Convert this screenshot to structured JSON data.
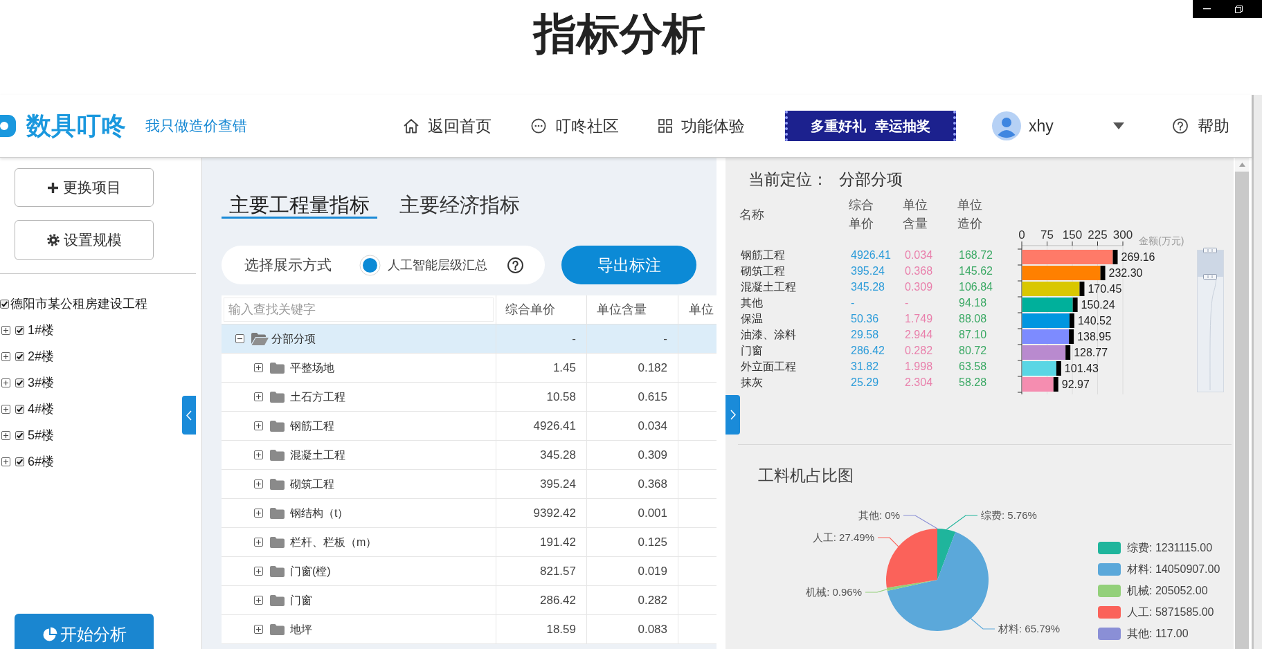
{
  "title": "指标分析",
  "header": {
    "logo": "数具叮咚",
    "slogan": "我只做造价查错",
    "nav": [
      {
        "label": "返回首页",
        "kind": "home"
      },
      {
        "label": "叮咚社区",
        "kind": "chat"
      },
      {
        "label": "功能体验",
        "kind": "grid"
      }
    ],
    "banner": "多重好礼 幸运抽奖",
    "user": {
      "name": "xhy"
    },
    "help": "帮助"
  },
  "sidebar": {
    "buttons": [
      {
        "label": "更换项目",
        "kind": "plus"
      },
      {
        "label": "设置规模",
        "kind": "gear"
      }
    ],
    "tree": [
      {
        "label": "德阳市某公租房建设工程",
        "checked": true,
        "children": [
          {
            "label": "1#楼",
            "checked": true,
            "expanded": false
          },
          {
            "label": "2#楼",
            "checked": true,
            "expanded": false
          },
          {
            "label": "3#楼",
            "checked": true,
            "expanded": false
          },
          {
            "label": "4#楼",
            "checked": true,
            "expanded": false
          },
          {
            "label": "5#楼",
            "checked": true,
            "expanded": false
          },
          {
            "label": "6#楼",
            "checked": true,
            "expanded": false
          }
        ]
      }
    ],
    "start_button": "开始分析"
  },
  "main": {
    "tabs": [
      {
        "label": "主要工程量指标",
        "selected": true
      },
      {
        "label": "主要经济指标",
        "selected": false
      }
    ],
    "display_mode": {
      "label": "选择展示方式",
      "options": [
        {
          "label": "人工智能层级汇总",
          "selected": true
        }
      ]
    },
    "export_button": "导出标注",
    "table": {
      "search": {
        "placeholder": "输入查找关键字"
      },
      "columns": [
        "综合单价",
        "单位含量",
        "单位"
      ],
      "rows": [
        {
          "name": "分部分项",
          "expanded": true,
          "selected": true,
          "cells": [
            "-",
            "-"
          ],
          "children": [
            {
              "name": "平整场地",
              "expanded": false,
              "selected": false,
              "cells": [
                "1.45",
                "0.182"
              ]
            },
            {
              "name": "土石方工程",
              "expanded": false,
              "selected": false,
              "cells": [
                "10.58",
                "0.615"
              ]
            },
            {
              "name": "钢筋工程",
              "expanded": false,
              "selected": false,
              "cells": [
                "4926.41",
                "0.034"
              ]
            },
            {
              "name": "混凝土工程",
              "expanded": false,
              "selected": false,
              "cells": [
                "345.28",
                "0.309"
              ]
            },
            {
              "name": "砌筑工程",
              "expanded": false,
              "selected": false,
              "cells": [
                "395.24",
                "0.368"
              ]
            },
            {
              "name": "钢结构（t）",
              "expanded": false,
              "selected": false,
              "cells": [
                "9392.42",
                "0.001"
              ]
            },
            {
              "name": "栏杆、栏板（m）",
              "expanded": false,
              "selected": false,
              "cells": [
                "191.42",
                "0.125"
              ]
            },
            {
              "name": "门窗(樘)",
              "expanded": false,
              "selected": false,
              "cells": [
                "821.57",
                "0.019"
              ]
            },
            {
              "name": "门窗",
              "expanded": false,
              "selected": false,
              "cells": [
                "286.42",
                "0.282"
              ]
            },
            {
              "name": "地坪",
              "expanded": false,
              "selected": false,
              "cells": [
                "18.59",
                "0.083"
              ]
            }
          ]
        }
      ]
    }
  },
  "detail": {
    "location_label": "当前定位：",
    "location": "分部分项",
    "columns": [
      "名称",
      "综合单价",
      "单位含量",
      "单位造价"
    ],
    "rows": [
      {
        "name": "钢筋工程",
        "unit_price": "4926.41",
        "unit_content": "0.034",
        "unit_cost": "168.72",
        "color": "#ff7a68"
      },
      {
        "name": "砌筑工程",
        "unit_price": "395.24",
        "unit_content": "0.368",
        "unit_cost": "145.62",
        "color": "#ff8000"
      },
      {
        "name": "混凝土工程",
        "unit_price": "345.28",
        "unit_content": "0.309",
        "unit_cost": "106.84",
        "color": "#d9c700"
      },
      {
        "name": "其他",
        "unit_price": "-",
        "unit_content": "-",
        "unit_cost": "94.18",
        "color": "#00b09b"
      },
      {
        "name": "保温",
        "unit_price": "50.36",
        "unit_content": "1.749",
        "unit_cost": "88.08",
        "color": "#0096e0"
      },
      {
        "name": "油漆、涂料",
        "unit_price": "29.58",
        "unit_content": "2.944",
        "unit_cost": "87.10",
        "color": "#7d8bff"
      },
      {
        "name": "门窗",
        "unit_price": "286.42",
        "unit_content": "0.282",
        "unit_cost": "80.72",
        "color": "#b98acf"
      },
      {
        "name": "外立面工程",
        "unit_price": "31.82",
        "unit_content": "1.998",
        "unit_cost": "63.58",
        "color": "#5ad6e4"
      },
      {
        "name": "抹灰",
        "unit_price": "25.29",
        "unit_content": "2.304",
        "unit_cost": "58.28",
        "color": "#f58db0"
      }
    ],
    "chart_data": {
      "type": "bar",
      "orientation": "horizontal",
      "grid": true,
      "xlabel": "金额(万元)",
      "xlim": [
        0,
        300
      ],
      "xticks": [
        0,
        75,
        150,
        225,
        300
      ],
      "values": [
        269.16,
        232.3,
        170.45,
        150.24,
        140.52,
        138.95,
        128.77,
        101.43,
        92.97
      ],
      "value_labels": [
        "269.16",
        "232.30",
        "170.45",
        "150.24",
        "140.52",
        "138.95",
        "128.77",
        "101.43",
        "92.97"
      ]
    }
  },
  "cost_breakdown": {
    "chart_data": {
      "type": "pie",
      "title": "工料机占比图",
      "values": [
        5.76,
        65.79,
        0.96,
        27.49,
        0
      ],
      "value_labels": [
        "综费: 5.76%",
        "材料: 65.79%",
        "机械: 0.96%",
        "人工: 27.49%",
        "其他: 0%"
      ]
    },
    "legend": [
      {
        "label": "综费: 1231115.00",
        "color": "#1fb59c"
      },
      {
        "label": "材料: 14050907.00",
        "color": "#5ba8da"
      },
      {
        "label": "机械: 205052.00",
        "color": "#93d07a"
      },
      {
        "label": "人工: 5871585.00",
        "color": "#fb625a"
      },
      {
        "label": "其他: 117.00",
        "color": "#8a8fd6"
      }
    ]
  }
}
